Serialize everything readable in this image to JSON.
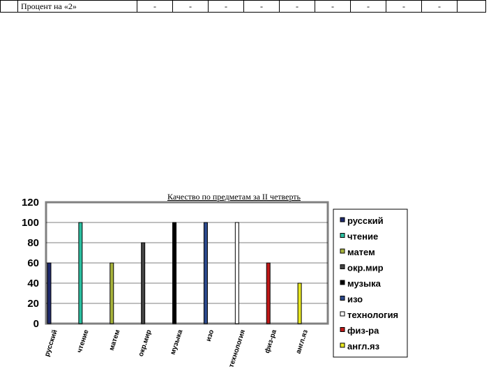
{
  "table": {
    "label": "Процент на «2»",
    "cells": [
      "-",
      "-",
      "-",
      "-",
      "-",
      "-",
      "-",
      "-",
      "-",
      ""
    ]
  },
  "chart_data": {
    "type": "bar",
    "title": "Качество  по предметам  за II четверть",
    "categories": [
      "русский",
      "чтение",
      "матем",
      "окр.мир",
      "музыка",
      "изо",
      "технология",
      "физ-ра",
      "англ.яз"
    ],
    "series": [
      {
        "name": "русский",
        "color": "#1f2a6e",
        "values": [
          60,
          0,
          0,
          0,
          0,
          0,
          0,
          0,
          0
        ]
      },
      {
        "name": "чтение",
        "color": "#2bbfa0",
        "values": [
          0,
          100,
          0,
          0,
          0,
          0,
          0,
          0,
          0
        ]
      },
      {
        "name": "матем",
        "color": "#a8b43c",
        "values": [
          0,
          0,
          60,
          0,
          0,
          0,
          0,
          0,
          0
        ]
      },
      {
        "name": "окр.мир",
        "color": "#444444",
        "values": [
          0,
          0,
          0,
          80,
          0,
          0,
          0,
          0,
          0
        ]
      },
      {
        "name": "музыка",
        "color": "#000000",
        "values": [
          0,
          0,
          0,
          0,
          100,
          0,
          0,
          0,
          0
        ]
      },
      {
        "name": "изо",
        "color": "#2d4a8c",
        "values": [
          0,
          0,
          0,
          0,
          0,
          100,
          0,
          0,
          0
        ]
      },
      {
        "name": "технология",
        "color": "#ffffff",
        "values": [
          0,
          0,
          0,
          0,
          0,
          0,
          100,
          0,
          0
        ]
      },
      {
        "name": "физ-ра",
        "color": "#c01818",
        "values": [
          0,
          0,
          0,
          0,
          0,
          0,
          0,
          60,
          0
        ]
      },
      {
        "name": "англ.яз",
        "color": "#e8e820",
        "values": [
          0,
          0,
          0,
          0,
          0,
          0,
          0,
          0,
          40
        ]
      }
    ],
    "yticks": [
      0,
      20,
      40,
      60,
      80,
      100,
      120
    ],
    "ylim": [
      0,
      120
    ],
    "grid": true,
    "legend": "right"
  }
}
